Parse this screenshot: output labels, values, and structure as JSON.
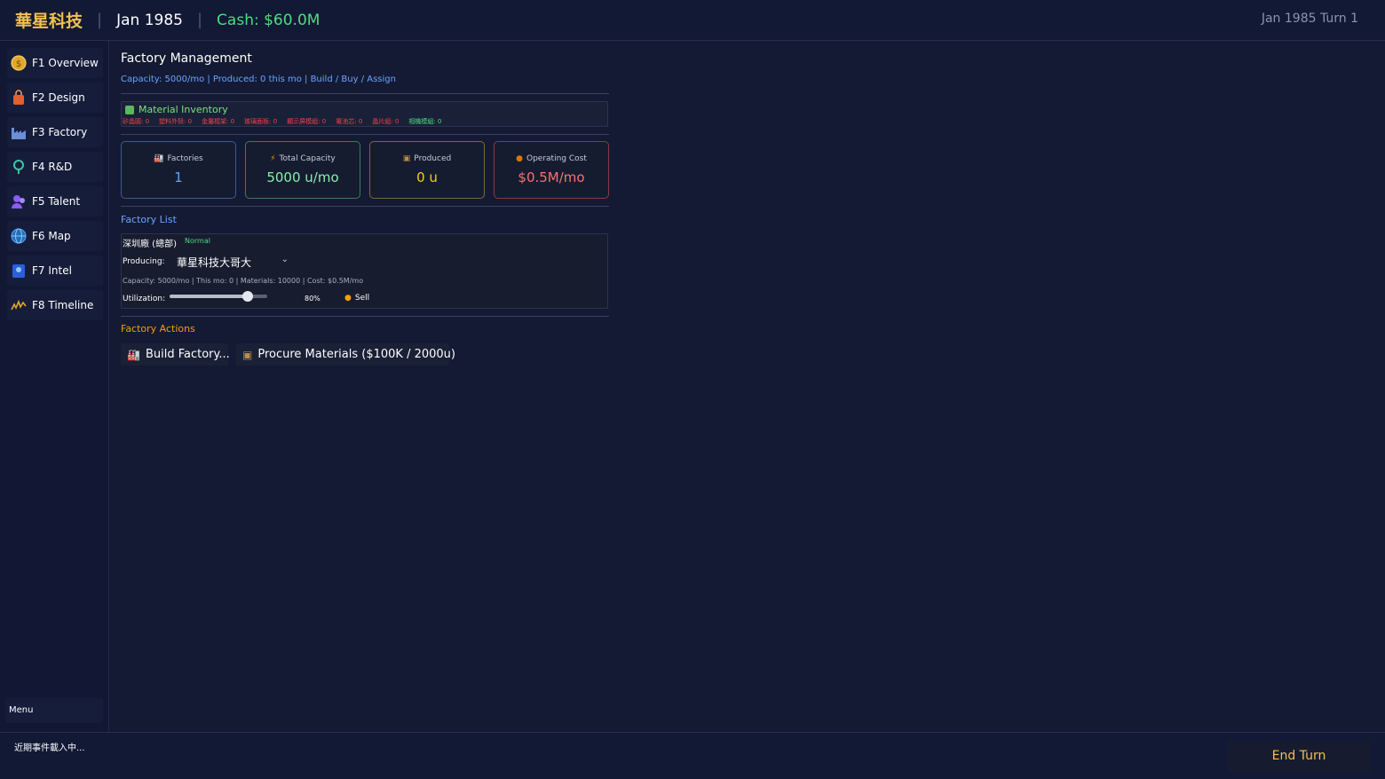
{
  "topbar": {
    "company": "華星科技",
    "date": "Jan 1985",
    "cash": "Cash: $60.0M",
    "turn": "Jan 1985 Turn 1"
  },
  "sidebar": {
    "items": [
      {
        "label": "F1 Overview",
        "icon": "coin-icon"
      },
      {
        "label": "F2 Design",
        "icon": "bag-icon"
      },
      {
        "label": "F3 Factory",
        "icon": "factory-icon"
      },
      {
        "label": "F4 R&D",
        "icon": "microscope-icon"
      },
      {
        "label": "F5 Talent",
        "icon": "people-icon"
      },
      {
        "label": "F6 Map",
        "icon": "globe-icon"
      },
      {
        "label": "F7 Intel",
        "icon": "spy-icon"
      },
      {
        "label": "F8 Timeline",
        "icon": "chart-icon"
      }
    ],
    "menu": "Menu"
  },
  "main": {
    "title": "Factory Management",
    "subtitle": "Capacity: 5000/mo | Produced: 0 this mo | Build / Buy / Assign",
    "inventory": {
      "title": "Material Inventory",
      "items": [
        {
          "text": "矽晶圓: 0",
          "color": "#ef4444"
        },
        {
          "text": "塑料外殼: 0",
          "color": "#ef4444"
        },
        {
          "text": "金屬框架: 0",
          "color": "#ef4444"
        },
        {
          "text": "玻璃面板: 0",
          "color": "#ef4444"
        },
        {
          "text": "顯示屏模組: 0",
          "color": "#ef4444"
        },
        {
          "text": "電池芯: 0",
          "color": "#ef4444"
        },
        {
          "text": "晶片組: 0",
          "color": "#ef4444"
        },
        {
          "text": "相機模組: 0",
          "color": "#4ade80"
        }
      ]
    },
    "stats": [
      {
        "label": "Factories",
        "value": "1",
        "color": "#60a5fa",
        "border": "#3b5b8f",
        "icon": "factory-icon"
      },
      {
        "label": "Total Capacity",
        "value": "5000 u/mo",
        "color": "#86efac",
        "border": "#3f7a5a",
        "icon": "lightning-icon"
      },
      {
        "label": "Produced",
        "value": "0 u",
        "color": "#facc15",
        "border": "#7a6a3a",
        "icon": "box-icon"
      },
      {
        "label": "Operating Cost",
        "value": "$0.5M/mo",
        "color": "#f87171",
        "border": "#8a3a3a",
        "icon": "money-bag-icon"
      }
    ],
    "factory_list": {
      "heading": "Factory List",
      "factory": {
        "name": "深圳廠 (總部)",
        "status": "Normal",
        "producing_label": "Producing:",
        "producing_value": "華星科技大哥大",
        "info": "Capacity: 5000/mo | This mo: 0 | Materials: 10000 | Cost: $0.5M/mo",
        "utilization_label": "Utilization:",
        "utilization": 0.8,
        "utilization_text": "80%",
        "sell": "Sell"
      }
    },
    "actions": {
      "heading": "Factory Actions",
      "build": "Build Factory...",
      "procure": "Procure Materials ($100K / 2000u)"
    }
  },
  "footer": {
    "events": "近期事件載入中...",
    "end_turn": "End Turn"
  },
  "colors": {
    "accent_gold": "#f2c14e",
    "cash_green": "#4ade80",
    "link_blue": "#6aa5ff"
  }
}
